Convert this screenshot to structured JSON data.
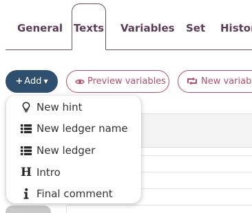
{
  "tabs": {
    "general": "General",
    "texts": "Texts",
    "variables": "Variables",
    "set": "Set",
    "history": "Histor",
    "active": "Texts"
  },
  "toolbar": {
    "add_label": "Add",
    "preview_label": "Preview variables",
    "new_variable_label": "New variab"
  },
  "add_menu": {
    "items": [
      {
        "label": "New hint",
        "icon": "lightbulb-icon"
      },
      {
        "label": "New ledger name",
        "icon": "list-icon"
      },
      {
        "label": "New ledger",
        "icon": "list-icon"
      },
      {
        "label": "Intro",
        "icon": "heading-icon",
        "glyph": "H"
      },
      {
        "label": "Final comment",
        "icon": "info-icon"
      }
    ]
  },
  "colors": {
    "accent": "#5a3c55",
    "primary_button": "#2f4f6e",
    "outline_button": "#b0506a"
  }
}
